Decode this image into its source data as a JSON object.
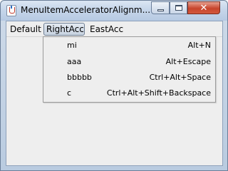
{
  "window": {
    "title": "MenuItemAcceleratorAlignm...",
    "controls": {
      "minimize_icon": "minimize-icon",
      "maximize_icon": "maximize-icon",
      "close_icon": "close-icon"
    }
  },
  "menubar": {
    "menus": [
      {
        "label": "Default"
      },
      {
        "label": "RightAcc",
        "state": "open"
      },
      {
        "label": "EastAcc"
      }
    ]
  },
  "popup": {
    "items": [
      {
        "label": "mi",
        "accelerator": "Alt+N"
      },
      {
        "label": "aaa",
        "accelerator": "Alt+Escape"
      },
      {
        "label": "bbbbb",
        "accelerator": "Ctrl+Alt+Space"
      },
      {
        "label": "c",
        "accelerator": "Ctrl+Alt+Shift+Backspace"
      }
    ]
  },
  "colors": {
    "titlebar": "#c6d6ea",
    "client_bg": "#eeeeee",
    "close_button": "#c7452d",
    "selected_menu": "#c8d3e1"
  }
}
